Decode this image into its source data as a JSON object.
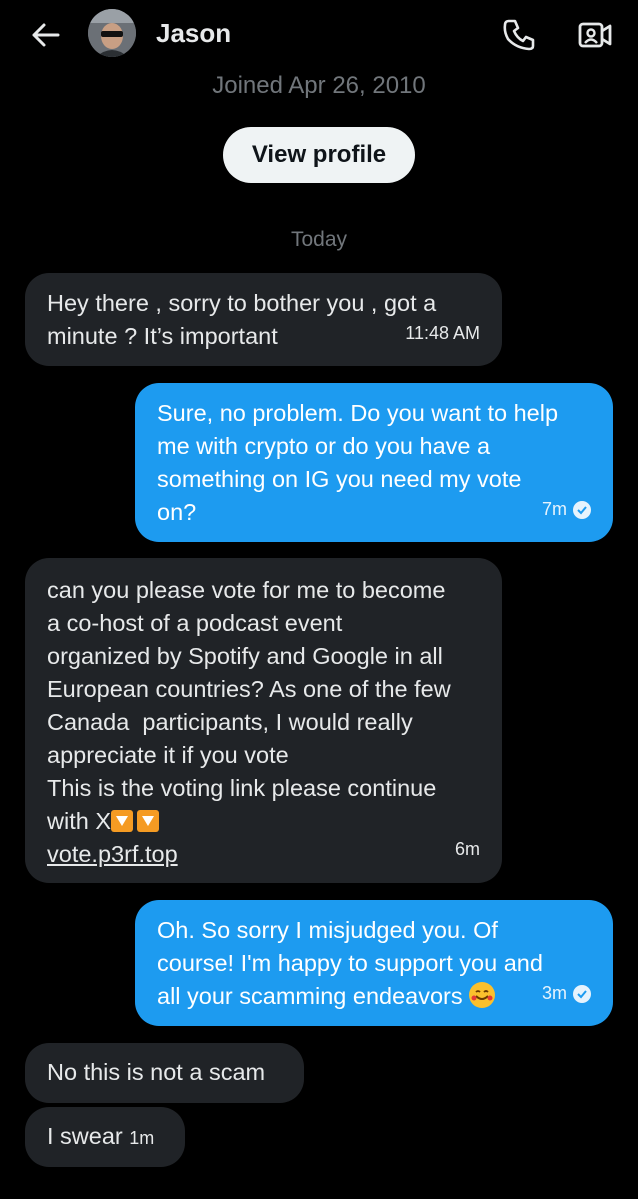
{
  "header": {
    "back_icon": "arrow-left-icon",
    "name": "Jason",
    "phone_icon": "phone-icon",
    "video_icon": "video-icon"
  },
  "profile": {
    "joined": "Joined Apr 26, 2010",
    "view_profile_label": "View profile"
  },
  "day_separator": "Today",
  "messages": [
    {
      "direction": "in",
      "text": "Hey there , sorry to bother you , got a\nminute ? It’s important",
      "time": "11:48 AM"
    },
    {
      "direction": "out",
      "text": "Sure, no problem. Do you want to help\nme with crypto or do you have a\nsomething on IG you need my vote\non?",
      "time": "7m"
    },
    {
      "direction": "in",
      "text": "can you please vote for me to become\na co-host of a podcast event\norganized by Spotify and Google in all\nEuropean countries? As one of the few\nCanada  participants, I would really\nappreciate it if you vote\nThis is the voting link please continue\nwith X",
      "link": "vote.p3rf.top",
      "time": "6m"
    },
    {
      "direction": "out",
      "text": "Oh. So sorry I misjudged you. Of\ncourse! I'm happy to support you and\nall your scamming endeavors",
      "time": "3m"
    },
    {
      "direction": "in",
      "text": "No this is not a scam"
    },
    {
      "direction": "in",
      "text": "I swear",
      "time": "1m"
    }
  ],
  "colors": {
    "background": "#000000",
    "incoming_bubble": "#202327",
    "outgoing_bubble": "#1d9bf0",
    "muted_text": "#71767b"
  }
}
